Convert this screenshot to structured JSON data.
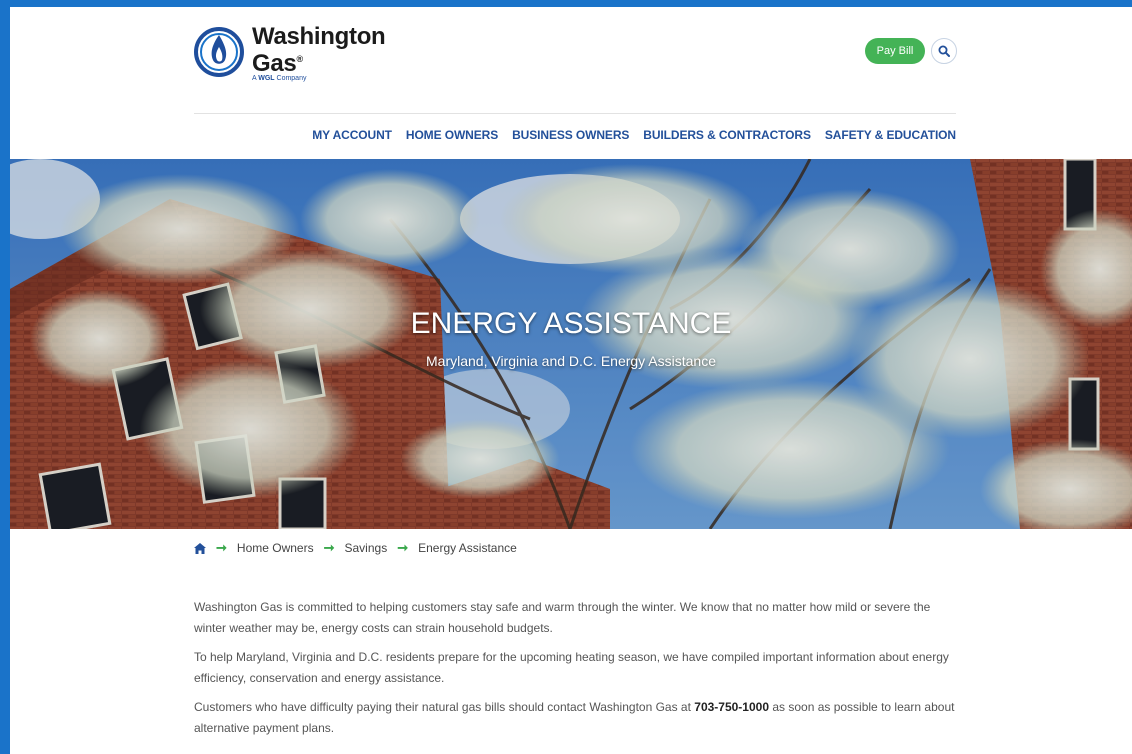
{
  "brand": {
    "name_line1": "Washington",
    "name_line2": "Gas",
    "trademark": "®",
    "tagline_prefix": "A ",
    "tagline_brand": "WGL",
    "tagline_suffix": " Company",
    "colors": {
      "logo_blue": "#1f4e9c",
      "logo_flame_blue": "#1a73c9"
    }
  },
  "header": {
    "pay_bill_label": "Pay Bill",
    "search_icon": "search-icon",
    "nav": [
      "MY ACCOUNT",
      "HOME OWNERS",
      "BUSINESS OWNERS",
      "BUILDERS & CONTRACTORS",
      "SAFETY & EDUCATION"
    ]
  },
  "hero": {
    "title": "ENERGY ASSISTANCE",
    "subtitle": "Maryland, Virginia and D.C. Energy Assistance"
  },
  "breadcrumb": {
    "home_icon": "home-icon",
    "items": [
      "Home Owners",
      "Savings",
      "Energy Assistance"
    ]
  },
  "content": {
    "p1": "Washington Gas is committed to helping customers stay safe and warm through the winter. We know that no matter how mild or severe the winter weather may be, energy costs can strain household budgets.",
    "p2": "To help Maryland, Virginia and D.C. residents prepare for the upcoming heating season, we have compiled important information about energy efficiency, conservation and energy assistance.",
    "p3_before": "Customers who have difficulty paying their natural gas bills should contact Washington Gas at ",
    "p3_phone": "703-750-1000",
    "p3_after": " as soon as possible to learn about alternative payment plans."
  },
  "colors": {
    "page_bg": "#1a73c9",
    "nav_text": "#23509a",
    "pay_bill_green": "#44b356",
    "breadcrumb_arrow": "#3aa84c",
    "body_text": "#555555"
  }
}
